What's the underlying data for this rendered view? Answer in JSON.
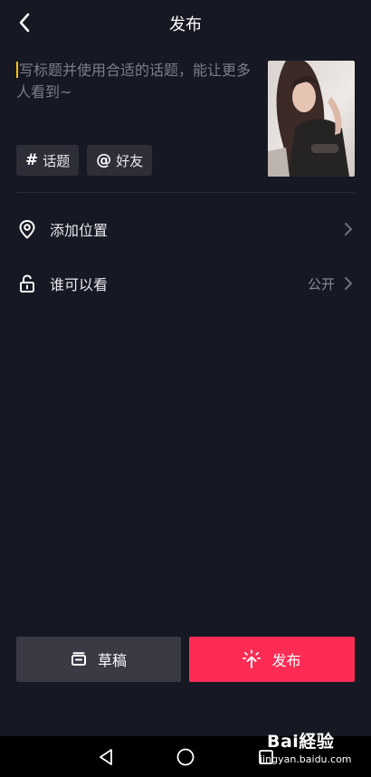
{
  "header": {
    "title": "发布",
    "back_icon": "chevron-left-icon"
  },
  "caption": {
    "placeholder": "写标题并使用合适的话题，能让更多人看到~"
  },
  "chips": [
    {
      "symbol": "#",
      "label": "话题"
    },
    {
      "symbol": "@",
      "label": "好友"
    }
  ],
  "options": [
    {
      "icon": "location-pin-icon",
      "label": "添加位置",
      "value": ""
    },
    {
      "icon": "unlock-icon",
      "label": "谁可以看",
      "value": "公开"
    }
  ],
  "actions": {
    "draft_label": "草稿",
    "publish_label": "发布"
  },
  "colors": {
    "background": "#161823",
    "accent": "#fe2c55",
    "chip": "#2d2e38",
    "caret": "#f8c21a"
  },
  "watermark": {
    "brand": "Bai経验",
    "url": "jingyan.baidu.com"
  }
}
